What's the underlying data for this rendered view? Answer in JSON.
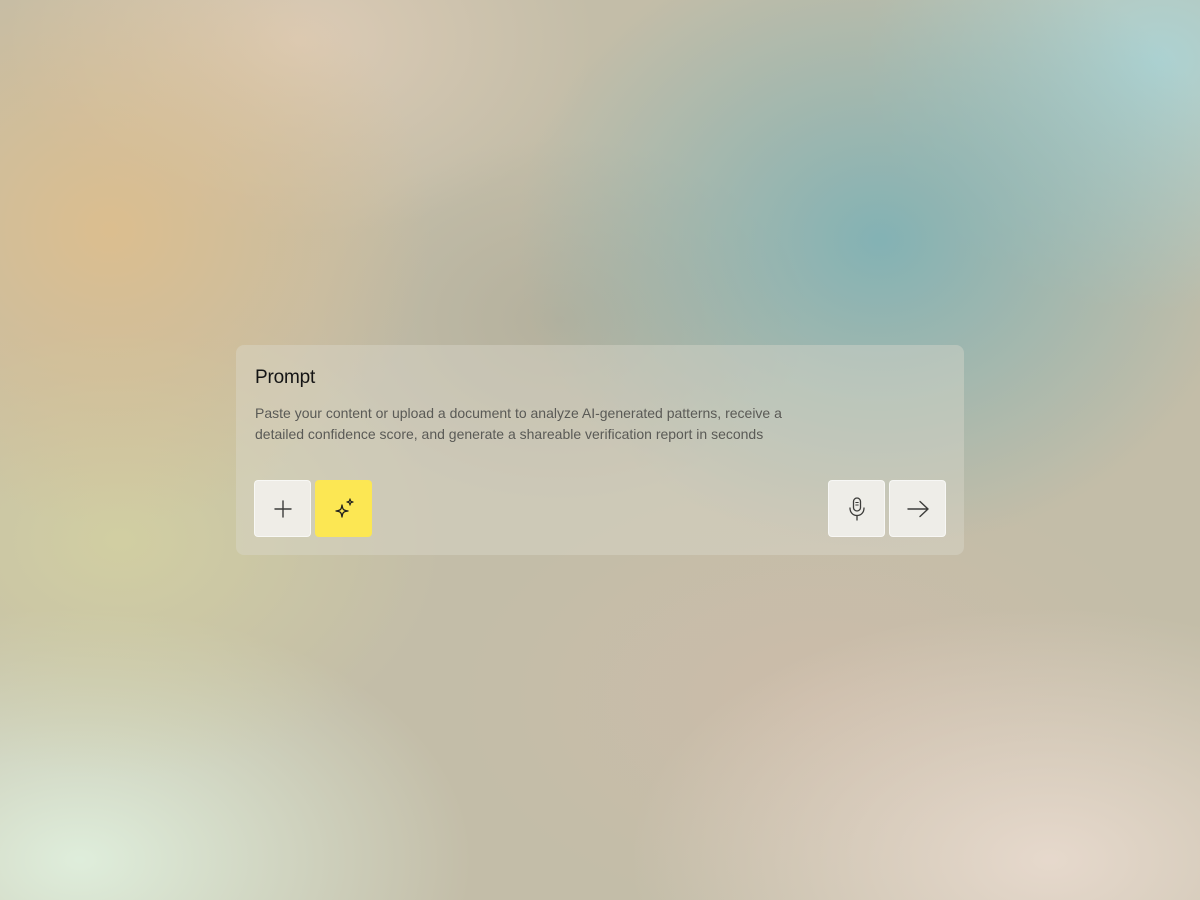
{
  "prompt": {
    "title": "Prompt",
    "description": "Paste your content or upload a document to analyze AI-generated patterns, receive a detailed confidence score, and generate a shareable verification report in seconds"
  },
  "toolbar": {
    "add_icon": "plus-icon",
    "generate_icon": "sparkles-icon",
    "voice_icon": "microphone-icon",
    "submit_icon": "arrow-right-icon"
  },
  "colors": {
    "accent": "#fce753",
    "button_bg": "#f1f0ec",
    "title_text": "#141414",
    "body_text": "#5a5a56"
  }
}
